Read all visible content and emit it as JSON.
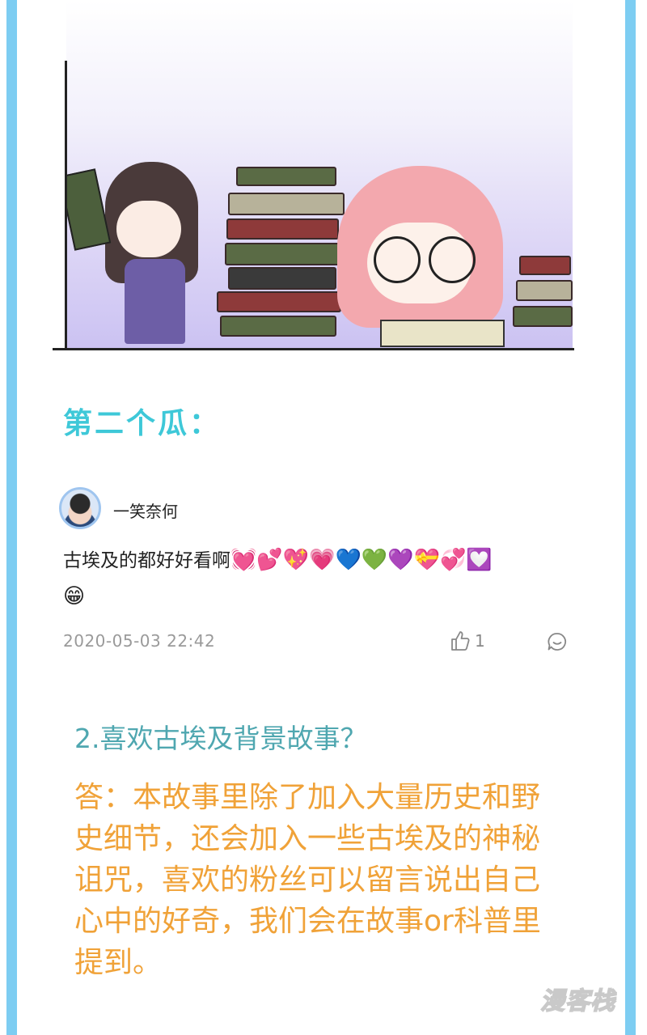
{
  "section": {
    "title": "第二个瓜："
  },
  "comment": {
    "username": "一笑奈何",
    "text": "古埃及的都好好看啊",
    "emojis": "💓💕💖💗💙💚💜💝💞💟",
    "emoji_line2": "😁",
    "timestamp": "2020-05-03 22:42",
    "likes": "1",
    "icons": {
      "like": "thumbs-up-icon",
      "reply": "comment-bubble-icon"
    }
  },
  "qa": {
    "question": "2.喜欢古埃及背景故事？",
    "answer": "答：本故事里除了加入大量历史和野史细节，还会加入一些古埃及的神秘诅咒，喜欢的粉丝可以留言说出自己心中的好奇，我们会在故事or科普里提到。"
  },
  "watermark": "漫客栈",
  "colors": {
    "border": "#7dcdf2",
    "section_title": "#3ec8d8",
    "question": "#4fa7b0",
    "answer": "#f0a238"
  }
}
